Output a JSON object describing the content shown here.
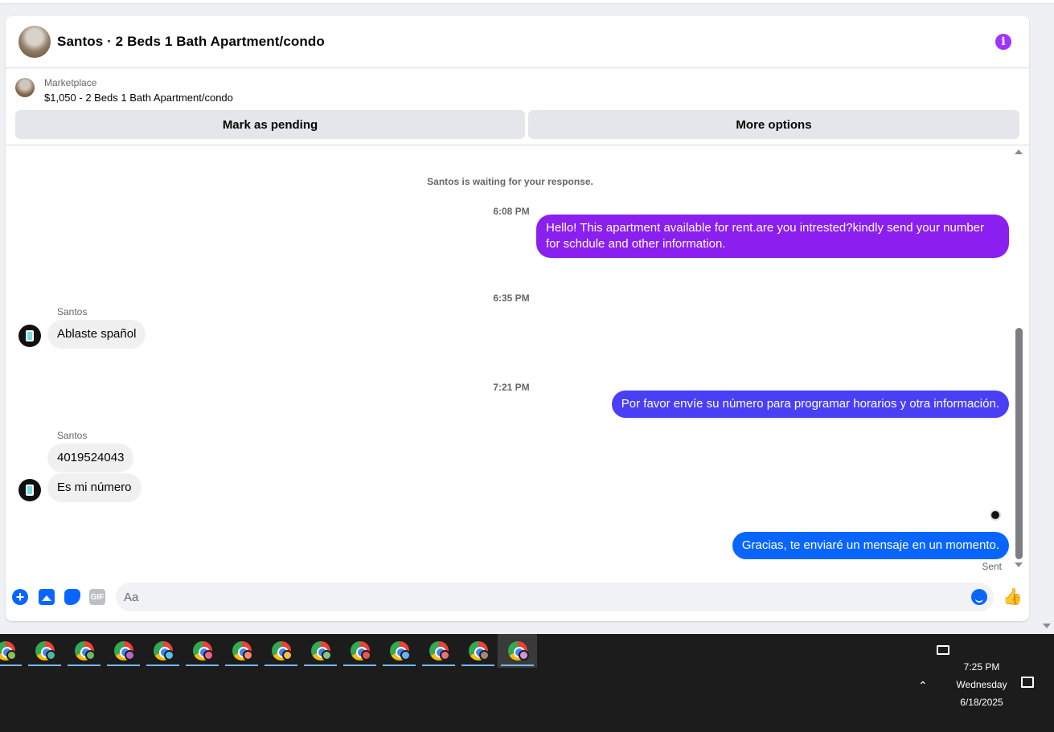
{
  "header": {
    "title": "Santos · 2 Beds 1 Bath Apartment/condo",
    "info_icon": "info-icon",
    "accent": "#a033ff"
  },
  "marketplace": {
    "label": "Marketplace",
    "listing": "$1,050 - 2 Beds 1 Bath Apartment/condo",
    "buttons": {
      "pending": "Mark as pending",
      "more": "More options"
    }
  },
  "conversation": {
    "system_note": "Santos is waiting for your response.",
    "timestamps": [
      "6:08 PM",
      "6:35 PM",
      "7:21 PM"
    ],
    "sender_name": "Santos",
    "messages": [
      {
        "from": "me",
        "text": "Hello! This apartment available for rent.are you intrested?kindly send your number for schdule and other information.",
        "color": "#8a1ff0"
      },
      {
        "from": "Santos",
        "text": "Ablaste spañol"
      },
      {
        "from": "me",
        "text": "Por favor envíe su número para programar horarios y otra información.",
        "color": "#4a3ff5"
      },
      {
        "from": "Santos",
        "text": "4019524043"
      },
      {
        "from": "Santos",
        "text": "Es mi número"
      },
      {
        "from": "me",
        "text": "Gracias, te enviaré un mensaje en un momento.",
        "color": "#0866ff"
      }
    ],
    "status": "Sent"
  },
  "composer": {
    "placeholder": "Aa",
    "icons": [
      "plus-icon",
      "photo-icon",
      "sticker-icon",
      "gif-icon",
      "emoji-icon",
      "thumbs-up-icon"
    ],
    "gif_label": "GIF"
  },
  "taskbar": {
    "app_count": 14,
    "badge_colors": [
      "#8bc34a",
      "#4db6ac",
      "#66bb6a",
      "#ba68c8",
      "#4fc3f7",
      "#f06292",
      "#ff8a65",
      "#ffb74d",
      "#81c784",
      "#ef5350",
      "#64b5f6",
      "#e57373",
      "#a1887f",
      "#ce93d8"
    ],
    "clock": {
      "time": "7:25 PM",
      "day": "Wednesday",
      "date": "6/18/2025"
    }
  }
}
